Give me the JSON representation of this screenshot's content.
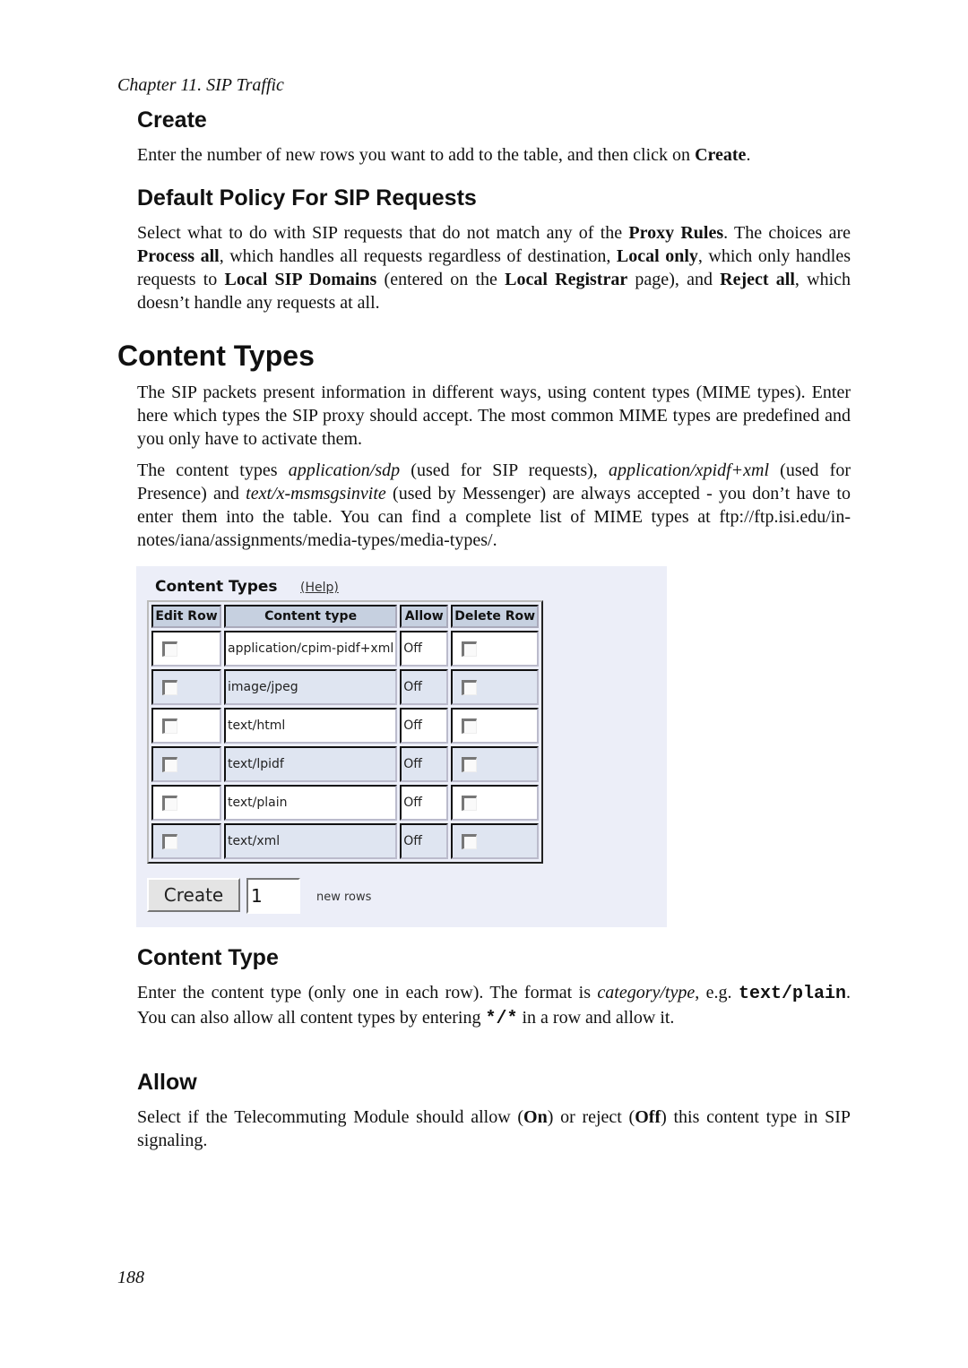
{
  "running_head": "Chapter 11. SIP Traffic",
  "sections": {
    "create": {
      "heading": "Create",
      "text_before": "Enter the number of new rows you want to add to the table, and then click on ",
      "bold": "Create",
      "text_after": "."
    },
    "default_policy": {
      "heading": "Default Policy For SIP Requests",
      "t1": "Select what to do with SIP requests that do not match any of the ",
      "b1": "Proxy Rules",
      "t2": ". The choices are ",
      "b2": "Process all",
      "t3": ", which handles all requests regardless of destination, ",
      "b3": "Local only",
      "t4": ", which only handles requests to ",
      "b4": "Local SIP Domains",
      "t5": " (entered on the ",
      "b5": "Local Registrar",
      "t6": " page), and ",
      "b6": "Reject all",
      "t7": ", which doesn’t handle any requests at all."
    },
    "content_types": {
      "heading": "Content Types",
      "para1": "The SIP packets present information in different ways, using content types (MIME types). Enter here which types the SIP proxy should accept. The most common MIME types are predefined and you only have to activate them.",
      "p2_t1": "The content types ",
      "p2_i1": "application/sdp",
      "p2_t2": " (used for SIP requests), ",
      "p2_i2": "application/xpidf+xml",
      "p2_t3": " (used for Presence) and ",
      "p2_i3": "text/x-msmsgsinvite",
      "p2_t4": " (used by Messenger) are always accepted - you don’t have to enter them into the table. You can find a complete list of MIME types at ftp://ftp.isi.edu/in-notes/iana/assignments/media-types/media-types/."
    },
    "content_type": {
      "heading": "Content Type",
      "t1": "Enter the content type (only one in each row). The format is ",
      "i1": "category/type",
      "t2": ", e.g. ",
      "m1": "text/plain",
      "t3": ". You can also allow all content types by entering ",
      "m2": "*/*",
      "t4": " in a row and allow it."
    },
    "allow": {
      "heading": "Allow",
      "t1": "Select if the Telecommuting Module should allow (",
      "b1": "On",
      "t2": ") or reject (",
      "b2": "Off",
      "t3": ") this content type in SIP signaling."
    }
  },
  "ui": {
    "title": "Content Types",
    "help_link": "(Help)",
    "columns": [
      "Edit Row",
      "Content type",
      "Allow",
      "Delete Row"
    ],
    "rows": [
      {
        "content_type": "application/cpim-pidf+xml",
        "allow": "Off",
        "edit_checked": false,
        "delete_checked": false
      },
      {
        "content_type": "image/jpeg",
        "allow": "Off",
        "edit_checked": false,
        "delete_checked": false
      },
      {
        "content_type": "text/html",
        "allow": "Off",
        "edit_checked": false,
        "delete_checked": false
      },
      {
        "content_type": "text/lpidf",
        "allow": "Off",
        "edit_checked": false,
        "delete_checked": false
      },
      {
        "content_type": "text/plain",
        "allow": "Off",
        "edit_checked": false,
        "delete_checked": false
      },
      {
        "content_type": "text/xml",
        "allow": "Off",
        "edit_checked": false,
        "delete_checked": false
      }
    ],
    "create_button": "Create",
    "new_rows_value": "1",
    "new_rows_label": "new rows"
  },
  "page_number": "188"
}
